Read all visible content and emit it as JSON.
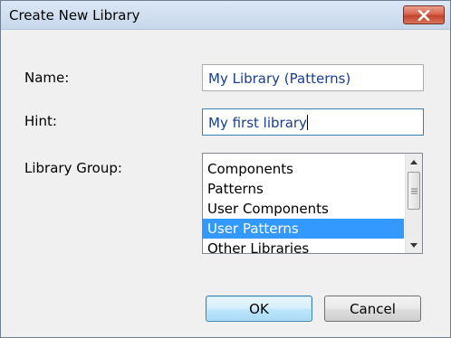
{
  "window": {
    "title": "Create New Library",
    "close_label": "close"
  },
  "form": {
    "name_label": "Name:",
    "name_value": "My Library (Patterns)",
    "hint_label": "Hint:",
    "hint_value": "My first library",
    "group_label": "Library Group:"
  },
  "library_groups": {
    "items": [
      "Components",
      "Patterns",
      "User Components",
      "User Patterns",
      "Other Libraries"
    ],
    "selected": "User Patterns"
  },
  "buttons": {
    "ok": "OK",
    "cancel": "Cancel"
  },
  "colors": {
    "selection": "#3399ff",
    "input_text": "#1a3d8f",
    "close_button": "#c3442c"
  }
}
